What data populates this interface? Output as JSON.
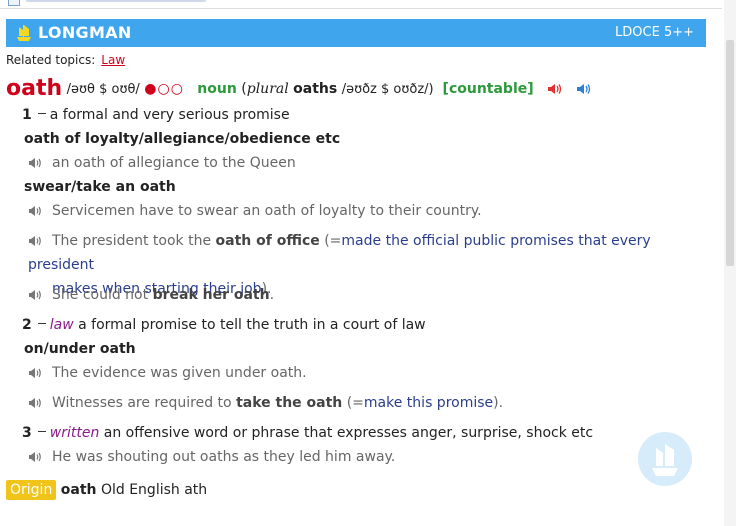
{
  "header": {
    "brand": "LONGMAN",
    "version": "LDOCE 5++"
  },
  "related": {
    "label": "Related topics:",
    "topic": "Law"
  },
  "entry": {
    "headword": "oath",
    "pron": "/əʊθ $ oʊθ/",
    "freq": "●○○",
    "pos": "noun",
    "plural_open": "(",
    "plural_label": "plural",
    "plural_word": "oaths",
    "plural_pron": "/əʊðz $ oʊðz/)",
    "gram_open": "[",
    "gram": "countable",
    "gram_close": "]"
  },
  "senses": [
    {
      "num": "1",
      "def": "a formal and very serious promise",
      "collocations": [
        "oath of loyalty/allegiance/obedience etc",
        "swear/take an oath"
      ],
      "examples": [
        "an oath of allegiance to the Queen",
        "Servicemen have to swear an oath of loyalty to their country.",
        "The president took the",
        "oath of office",
        "(=",
        "made the official public promises that every president",
        "makes when starting their job",
        ").",
        "She could not",
        "break her oath",
        "."
      ]
    },
    {
      "num": "2",
      "register": "law",
      "def": "a formal promise to tell the truth in a court of law",
      "collocation": "on/under oath",
      "examples": [
        "The evidence was given under oath.",
        "Witnesses are required to",
        "take the oath",
        "(=",
        "make this promise",
        ")."
      ]
    },
    {
      "num": "3",
      "register": "written",
      "def": "an offensive word or phrase that expresses anger, surprise, shock etc",
      "examples": [
        "He was shouting out oaths as they led him away."
      ]
    }
  ],
  "origin": {
    "tag": "Origin",
    "word": "oath",
    "text": "Old English ath"
  },
  "colors": {
    "header": "#3fa5ec",
    "headword": "#d0021b",
    "pos": "#2c9a3a",
    "gloss": "#2b3e8c",
    "origin": "#f0c419"
  }
}
